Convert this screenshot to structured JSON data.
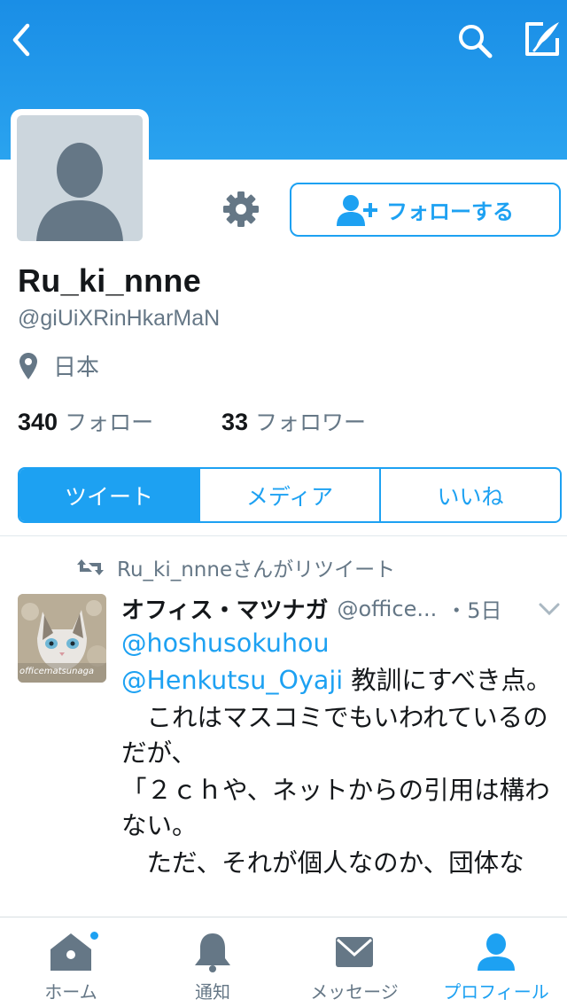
{
  "header": {
    "back_icon": "chevron-left-icon",
    "search_icon": "search-icon",
    "compose_icon": "compose-icon"
  },
  "profile": {
    "display_name": "Ru_ki_nnne",
    "handle": "@giUiXRinHkarMaN",
    "location": "日本",
    "following_count": "340",
    "following_label": "フォロー",
    "followers_count": "33",
    "followers_label": "フォロワー",
    "follow_button_label": "フォローする"
  },
  "segments": {
    "tweets": "ツイート",
    "media": "メディア",
    "likes": "いいね",
    "selected": "ツイート"
  },
  "tweet": {
    "retweet_note": "Ru_ki_nnneさんがリツイート",
    "author_name": "オフィス・マツナガ",
    "author_handle": "@office...",
    "time": "・5日",
    "avatar_caption": "officematsunaga",
    "line1_mention": "@hoshusokuhou",
    "line2_mention": "@Henkutsu_Oyaji",
    "line2_text": " 教訓にすべき点。",
    "para1": "　これはマスコミでもいわれているのだが、",
    "para2": "「２ｃｈや、ネットからの引用は構わない。",
    "para3": "　ただ、それが個人なのか、団体な"
  },
  "tabbar": {
    "home": "ホーム",
    "notifications": "通知",
    "messages": "メッセージ",
    "profile": "プロフィール",
    "active": "プロフィール"
  },
  "colors": {
    "brand": "#1da1f2",
    "banner": "#1a8ee6",
    "secondary_text": "#657786"
  }
}
